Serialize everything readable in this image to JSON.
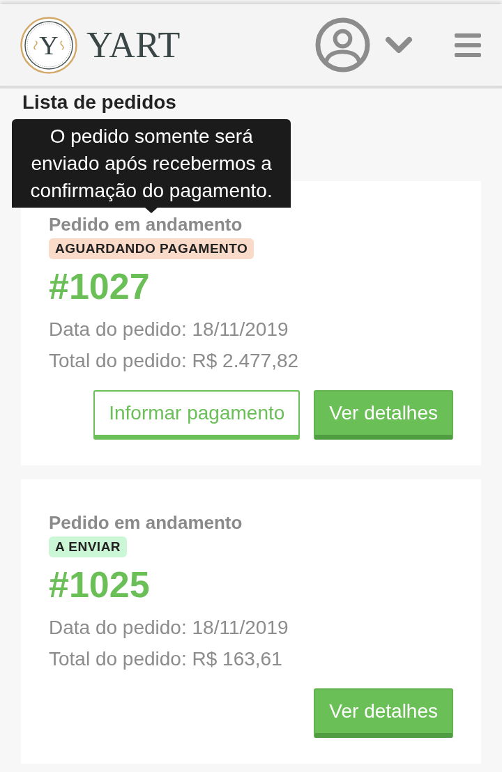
{
  "header": {
    "logo_letter": "Y",
    "brand": "YART"
  },
  "page": {
    "title": "Lista de pedidos"
  },
  "orders": [
    {
      "title": "Pedido em andamento",
      "status": {
        "label": "AGUARDANDO PAGAMENTO",
        "color": "#fadbc9"
      },
      "tooltip": "O pedido somente será enviado após recebermos a confirmação do pagamento.",
      "number": "#1027",
      "date": "Data do pedido: 18/11/2019",
      "total": "Total do pedido: R$ 2.477,82",
      "buttons": [
        {
          "label": "Informar pagamento",
          "kind": "outline"
        },
        {
          "label": "Ver detalhes",
          "kind": "primary"
        }
      ]
    },
    {
      "title": "Pedido em andamento",
      "status": {
        "label": "A ENVIAR",
        "color": "#ccf7d6"
      },
      "number": "#1025",
      "date": "Data do pedido: 18/11/2019",
      "total": "Total do pedido: R$ 163,61",
      "buttons": [
        {
          "label": "Ver detalhes",
          "kind": "primary"
        }
      ]
    }
  ]
}
